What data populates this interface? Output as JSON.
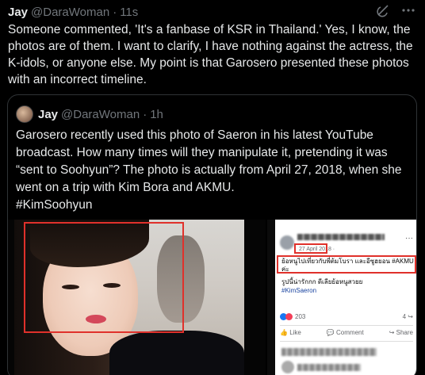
{
  "tweet": {
    "display_name": "Jay",
    "handle": "@DaraWoman",
    "separator": "·",
    "time": "11s",
    "text": "Someone commented, 'It's a fanbase of KSR in Thailand.' Yes, I know, the photos are of them. I want to clarify, I have nothing against the actress, the K-idols, or anyone else. My point is that Garosero presented these photos with an incorrect timeline."
  },
  "quote": {
    "display_name": "Jay",
    "handle": "@DaraWoman",
    "separator": "·",
    "time": "1h",
    "text": "Garosero recently used this photo of Saeron in his latest YouTube broadcast. How many times will they manipulate it, pretending it was “sent to Soohyun”? The photo is actually from April 27, 2018, when she went on a trip with Kim Bora and AKMU.",
    "hashtag": "#KimSoohyun"
  },
  "fb_post": {
    "date": "27 April 2018 · ",
    "thai_line": "ย้อหนูไปเที่ยวกับพี่ต้มโบรา และอีซูฮยอน #AKMU ค่ะ",
    "line2": "รูปนี้น่ารักกก ดีเลียย้อหนูสวยย",
    "tag": "#KimSaeron",
    "reactions": "203",
    "shares": "4",
    "like": "Like",
    "comment": "Comment",
    "share": "Share"
  },
  "icons": {
    "grok": "grok-icon",
    "more": "more-icon"
  },
  "colors": {
    "background": "#000000",
    "text": "#e7e9ea",
    "muted": "#71767b",
    "highlight_box": "#e0312b",
    "hashtag": "#1a44a0"
  }
}
